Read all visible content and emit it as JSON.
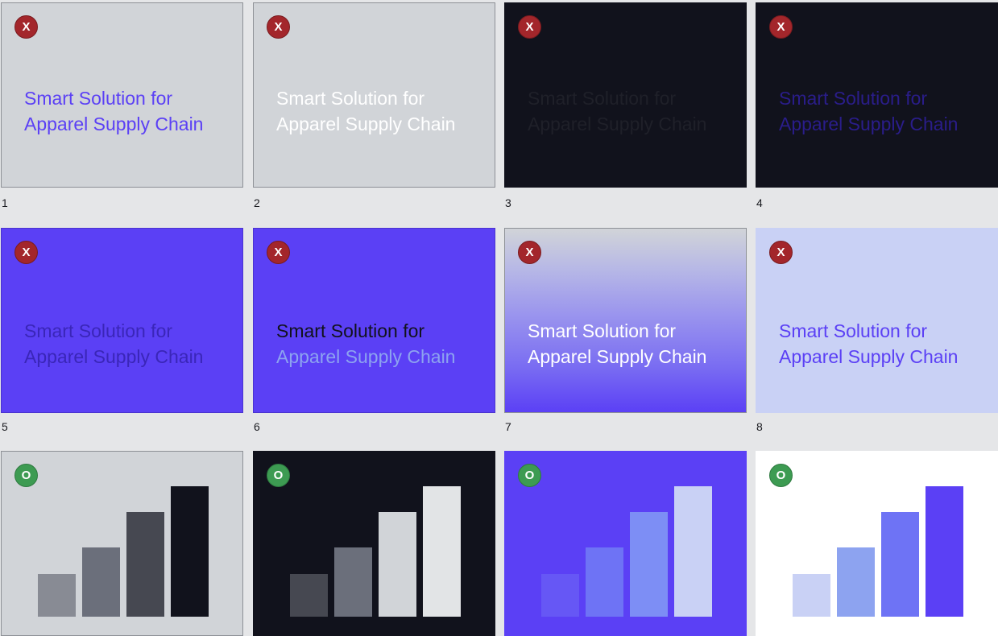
{
  "headline": {
    "line1": "Smart Solution for",
    "line2": "Apparel Supply Chain"
  },
  "badges": {
    "wrong": "X",
    "right": "O"
  },
  "numbers": [
    "1",
    "2",
    "3",
    "4",
    "5",
    "6",
    "7",
    "8"
  ],
  "colors": {
    "page_bg": "#e5e6e8",
    "light_gray": "#d1d4d8",
    "dark": "#11121c",
    "purple": "#5b40f5",
    "lavender": "#c9d1f5",
    "white": "#ffffff",
    "wrong_badge": "#a3262b",
    "right_badge": "#3d9b52"
  },
  "bar_charts": [
    {
      "background": "#d1d4d8",
      "bar_colors": [
        "#888b94",
        "#6b6f7b",
        "#464851",
        "#11121c"
      ],
      "relative_heights": [
        0.33,
        0.53,
        0.8,
        1.0
      ]
    },
    {
      "background": "#11121c",
      "bar_colors": [
        "#464851",
        "#6b6f7b",
        "#d1d4d8",
        "#e2e4e6"
      ],
      "relative_heights": [
        0.33,
        0.53,
        0.8,
        1.0
      ]
    },
    {
      "background": "#5b40f5",
      "bar_colors": [
        "#6657f5",
        "#6e73f5",
        "#7d8ef5",
        "#c9d1f5"
      ],
      "relative_heights": [
        0.33,
        0.53,
        0.8,
        1.0
      ]
    },
    {
      "background": "#ffffff",
      "bar_colors": [
        "#c9d1f5",
        "#8da3f0",
        "#6e73f5",
        "#5b40f5"
      ],
      "relative_heights": [
        0.33,
        0.53,
        0.8,
        1.0
      ]
    }
  ]
}
